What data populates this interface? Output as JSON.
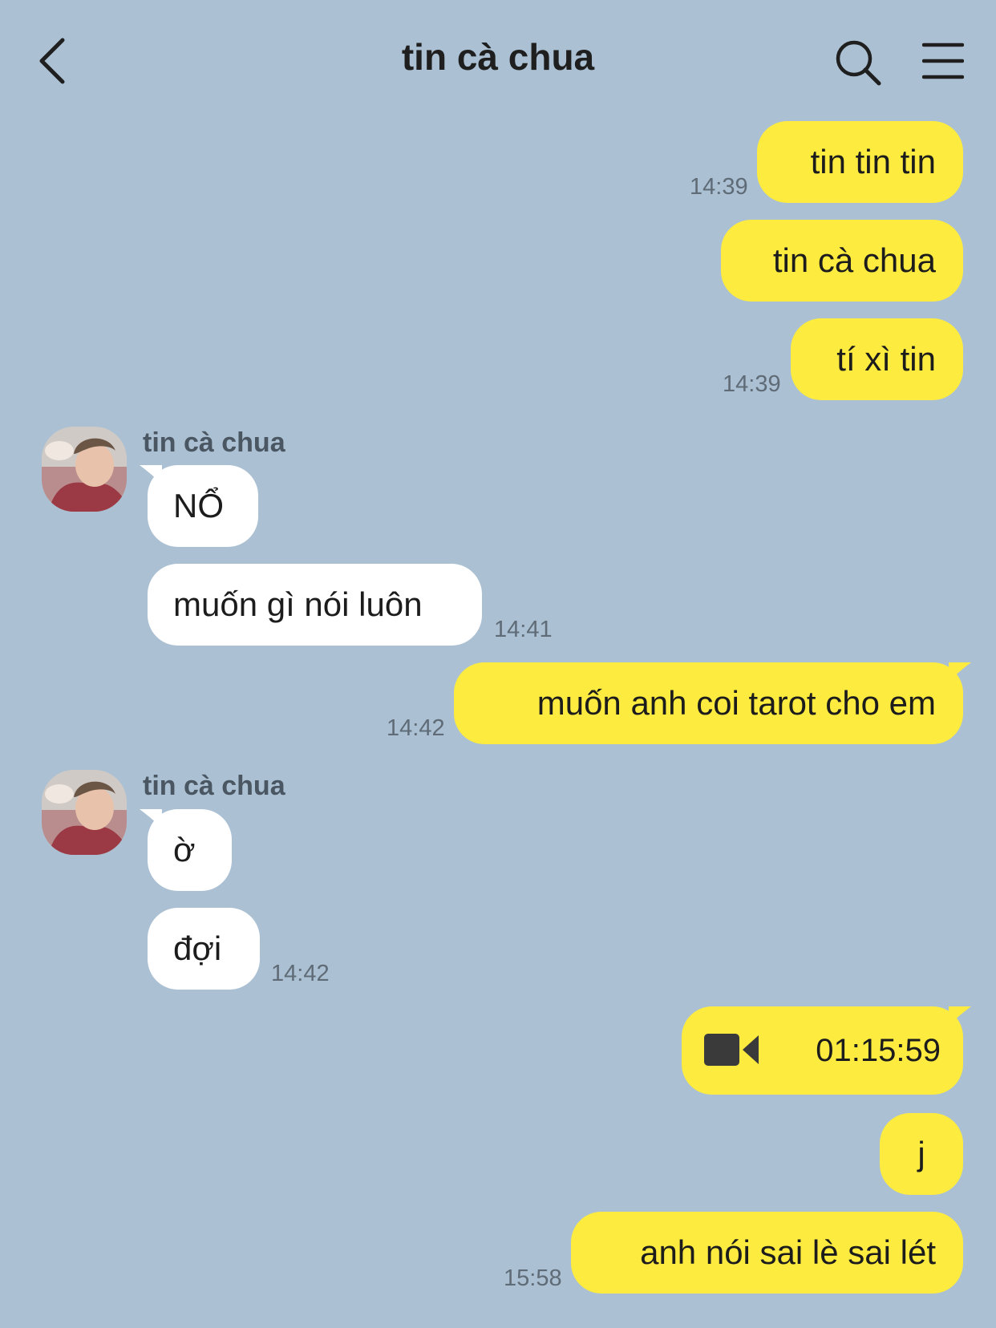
{
  "header": {
    "title": "tin cà chua"
  },
  "contact_name": "tin cà chua",
  "messages": [
    {
      "text": "tin tin tin"
    },
    {
      "text": "tin cà chua"
    },
    {
      "text": "tí xì tin"
    },
    {
      "text": "NỔ"
    },
    {
      "text": "muốn gì nói luôn"
    },
    {
      "text": "muốn anh coi tarot cho em"
    },
    {
      "text": "ờ"
    },
    {
      "text": "đợi"
    },
    {
      "text": "j"
    },
    {
      "text": "anh nói sai lè sai lét"
    }
  ],
  "video_call": {
    "duration": "01:15:59"
  },
  "times": [
    "14:39",
    "14:39",
    "14:41",
    "14:42",
    "14:42",
    "15:58"
  ],
  "colors": {
    "background": "#abc1d3",
    "mine": "#fdeb3f",
    "theirs": "#ffffff"
  }
}
